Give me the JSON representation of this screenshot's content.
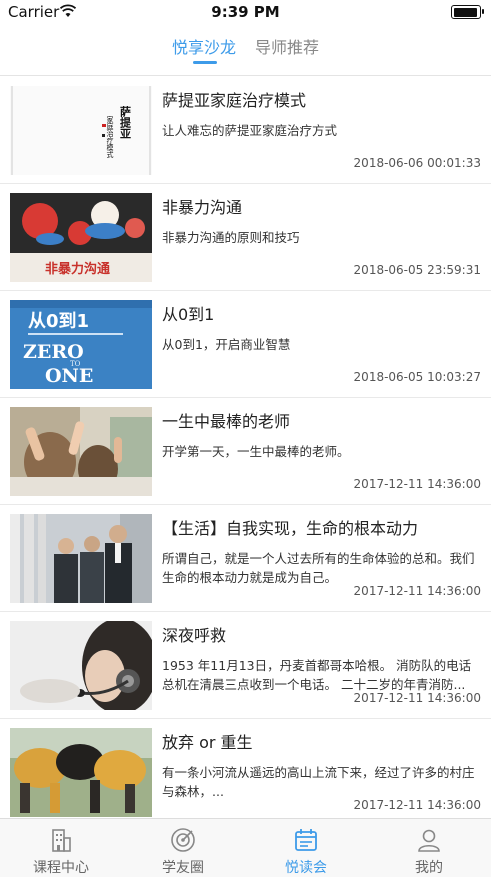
{
  "status": {
    "carrier": "Carrier",
    "time": "9:39 PM"
  },
  "top_tabs": [
    {
      "label": "悦享沙龙",
      "active": true
    },
    {
      "label": "导师推荐",
      "active": false
    }
  ],
  "items": [
    {
      "title": "萨提亚家庭治疗模式",
      "desc": "让人难忘的萨提亚家庭治疗方式",
      "time": "2018-06-06 00:01:33",
      "cover_text": "萨提亚家庭治疗模式"
    },
    {
      "title": "非暴力沟通",
      "desc": "非暴力沟通的原则和技巧",
      "time": "2018-06-05 23:59:31",
      "cover_text": "非暴力沟通"
    },
    {
      "title": "从0到1",
      "desc": "从0到1，开启商业智慧",
      "time": "2018-06-05 10:03:27",
      "cover_text": "从0到1 ZERO ONE"
    },
    {
      "title": "一生中最棒的老师",
      "desc": "开学第一天，一生中最棒的老师。",
      "time": "2017-12-11 14:36:00"
    },
    {
      "title": "【生活】自我实现，生命的根本动力",
      "desc": "所谓自己，就是一个人过去所有的生命体验的总和。我们生命的根本动力就是成为自己。",
      "time": "2017-12-11 14:36:00"
    },
    {
      "title": "深夜呼救",
      "desc": "1953 年11月13日，丹麦首都哥本哈根。 消防队的电话总机在清晨三点收到一个电话。 二十二岁的年青消防...",
      "time": "2017-12-11 14:36:00"
    },
    {
      "title": "放弃 or 重生",
      "desc": "有一条小河流从遥远的高山上流下来，经过了许多的村庄与森林，...",
      "time": "2017-12-11 14:36:00"
    }
  ],
  "tab_bar": [
    {
      "label": "课程中心",
      "icon": "building-icon",
      "active": false
    },
    {
      "label": "学友圈",
      "icon": "target-icon",
      "active": false
    },
    {
      "label": "悦读会",
      "icon": "calendar-icon",
      "active": true
    },
    {
      "label": "我的",
      "icon": "user-icon",
      "active": false
    }
  ],
  "colors": {
    "accent": "#3d9be9",
    "inactive": "#666666"
  }
}
